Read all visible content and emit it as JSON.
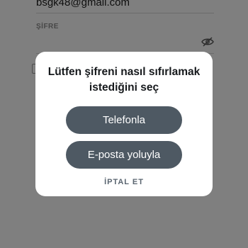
{
  "form": {
    "email_value": "bsgk48@gmail.com",
    "password_label": "ŞİFRE",
    "password_visibility_icon": "eye-slash-icon"
  },
  "dialog": {
    "title": "Lütfen şifreni nasıl sıfırlamak istediğini seç",
    "phone_button": "Telefonla",
    "email_button": "E-posta yoluyla",
    "cancel_button": "İPTAL ET"
  },
  "colors": {
    "overlay": "rgba(0,0,0,0.5)",
    "button_bg": "#4e5963",
    "button_text": "#ffffff",
    "dialog_bg": "#ffffff"
  }
}
